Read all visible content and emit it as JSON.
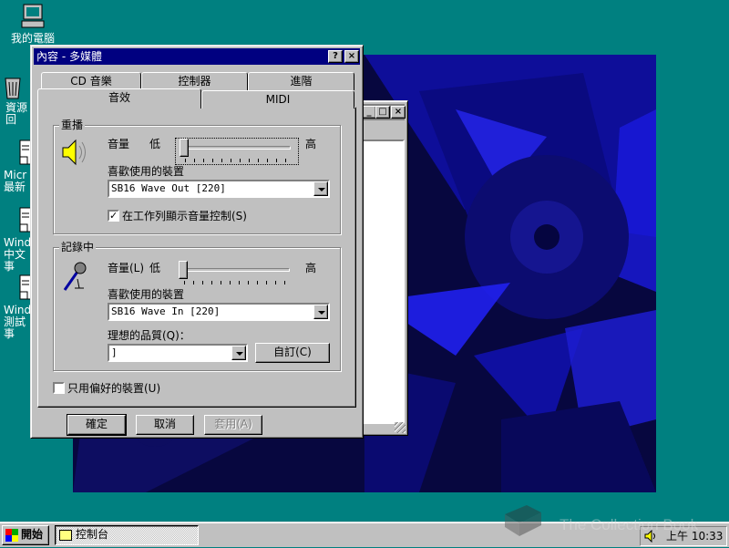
{
  "desktop": {
    "icons": [
      {
        "label": "我的電腦"
      },
      {
        "label": "資源回"
      },
      {
        "label": "Micr 最新"
      },
      {
        "label": "Windo 中文 事"
      },
      {
        "label": "Windo 測試 事"
      }
    ]
  },
  "bg_window": {
    "buttons": [
      "_",
      "□",
      "×"
    ]
  },
  "dialog": {
    "title": "內容 - 多媒體",
    "help_btn": "?",
    "close_btn": "×",
    "tabs_back": [
      "CD 音樂",
      "控制器",
      "進階"
    ],
    "tabs_front": [
      "音效",
      "MIDI"
    ],
    "playback": {
      "group_label": "重播",
      "volume_label": "音量",
      "low": "低",
      "high": "高",
      "volume_level": 0.0,
      "device_label": "喜歡使用的裝置",
      "device_value": "SB16 Wave Out [220]",
      "show_volume_checkbox": "在工作列顯示音量控制(S)",
      "show_volume_checked": true
    },
    "recording": {
      "group_label": "記錄中",
      "volume_label": "音量(L)",
      "low": "低",
      "high": "高",
      "volume_level": 0.0,
      "device_label": "喜歡使用的裝置",
      "device_value": "SB16 Wave In [220]",
      "quality_label": "理想的品質(Q)：",
      "quality_value": "]",
      "customize_btn": "自訂(C)"
    },
    "only_preferred": "只用偏好的裝置(U)",
    "only_preferred_checked": false,
    "ok": "確定",
    "cancel": "取消",
    "apply": "套用(A)"
  },
  "taskbar": {
    "start": "開始",
    "task": "控制台",
    "time": "上午 10:33"
  },
  "watermark": "The Collection Book",
  "colors": {
    "desktop": "#008080",
    "titlebar": "#000080",
    "wallpaper": "#06063a"
  }
}
